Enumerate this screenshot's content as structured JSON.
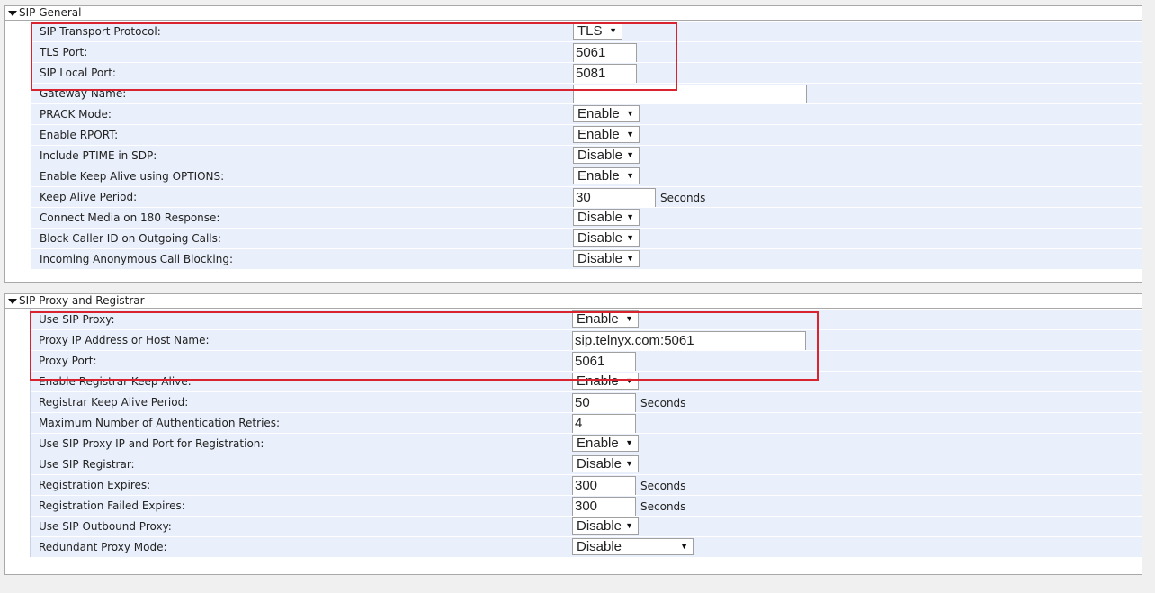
{
  "sip_general": {
    "title": "SIP General",
    "rows": [
      {
        "label": "SIP Transport Protocol:",
        "type": "select",
        "value": "TLS"
      },
      {
        "label": "TLS Port:",
        "type": "input",
        "value": "5061"
      },
      {
        "label": "SIP Local Port:",
        "type": "input",
        "value": "5081"
      },
      {
        "label": "Gateway Name:",
        "type": "input",
        "value": ""
      },
      {
        "label": "PRACK Mode:",
        "type": "select",
        "value": "Enable"
      },
      {
        "label": "Enable RPORT:",
        "type": "select",
        "value": "Enable"
      },
      {
        "label": "Include PTIME in SDP:",
        "type": "select",
        "value": "Disable"
      },
      {
        "label": "Enable Keep Alive using OPTIONS:",
        "type": "select",
        "value": "Enable"
      },
      {
        "label": "Keep Alive Period:",
        "type": "input",
        "value": "30",
        "unit": "Seconds"
      },
      {
        "label": "Connect Media on 180 Response:",
        "type": "select",
        "value": "Disable"
      },
      {
        "label": "Block Caller ID on Outgoing Calls:",
        "type": "select",
        "value": "Disable"
      },
      {
        "label": "Incoming Anonymous Call Blocking:",
        "type": "select",
        "value": "Disable"
      }
    ]
  },
  "sip_proxy": {
    "title": "SIP Proxy and Registrar",
    "rows": [
      {
        "label": "Use SIP Proxy:",
        "type": "select",
        "value": "Enable"
      },
      {
        "label": "Proxy IP Address or Host Name:",
        "type": "input",
        "value": "sip.telnyx.com:5061"
      },
      {
        "label": "Proxy Port:",
        "type": "input",
        "value": "5061"
      },
      {
        "label": "Enable Registrar Keep Alive:",
        "type": "select",
        "value": "Enable"
      },
      {
        "label": "Registrar Keep Alive Period:",
        "type": "input",
        "value": "50",
        "unit": "Seconds"
      },
      {
        "label": "Maximum Number of Authentication Retries:",
        "type": "input",
        "value": "4"
      },
      {
        "label": "Use SIP Proxy IP and Port for Registration:",
        "type": "select",
        "value": "Enable"
      },
      {
        "label": "Use SIP Registrar:",
        "type": "select",
        "value": "Disable"
      },
      {
        "label": "Registration Expires:",
        "type": "input",
        "value": "300",
        "unit": "Seconds"
      },
      {
        "label": "Registration Failed Expires:",
        "type": "input",
        "value": "300",
        "unit": "Seconds"
      },
      {
        "label": "Use SIP Outbound Proxy:",
        "type": "select",
        "value": "Disable"
      },
      {
        "label": "Redundant Proxy Mode:",
        "type": "select",
        "value": "Disable"
      }
    ]
  },
  "colors": {
    "highlight": "#d9232e",
    "row_background": "#eaf0fb"
  },
  "icons": {
    "section_toggle": "caret-down-icon",
    "select_arrow": "dropdown-arrow-icon"
  }
}
